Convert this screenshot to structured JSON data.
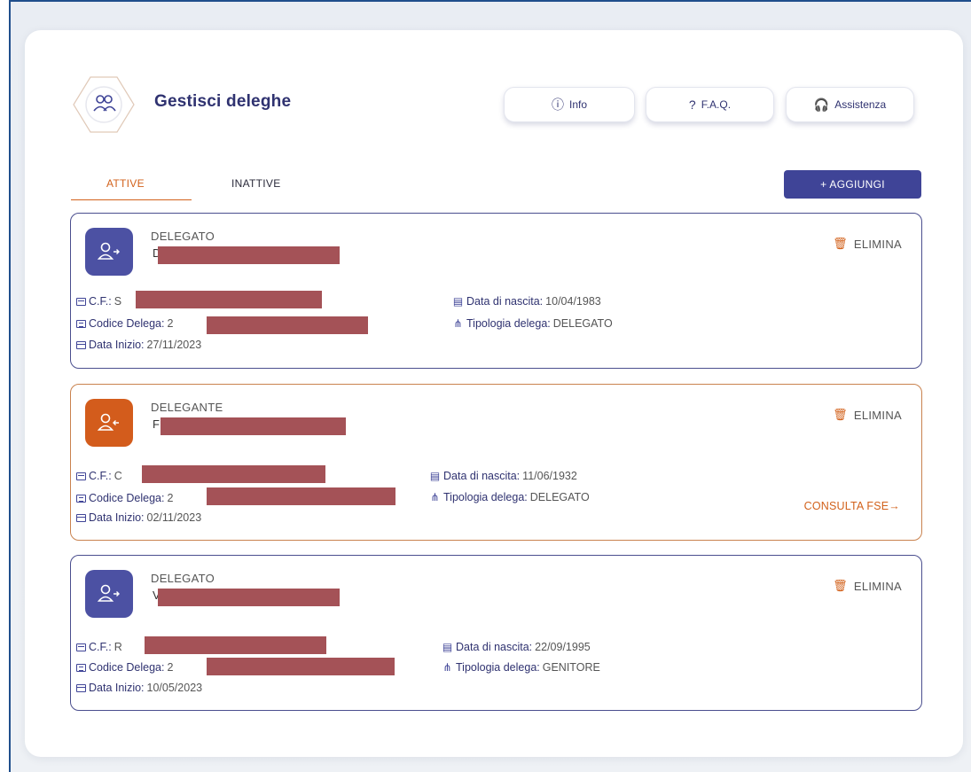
{
  "header": {
    "title": "Gestisci deleghe",
    "buttons": {
      "info": "Info",
      "faq": "F.A.Q.",
      "assistenza": "Assistenza"
    }
  },
  "tabs": {
    "active": "ATTIVE",
    "inactive": "INATTIVE"
  },
  "add_button": "+ AGGIUNGI",
  "labels": {
    "cf": "C.F.:",
    "codice": "Codice Delega:",
    "data_inizio": "Data Inizio:",
    "data_nascita": "Data di nascita:",
    "tipologia": "Tipologia delega:",
    "elimina": "ELIMINA",
    "consulta": "CONSULTA FSE→"
  },
  "cards": [
    {
      "role": "DELEGATO",
      "name_initial": "D",
      "cf_initial": "S",
      "codice_initial": "2",
      "data_inizio": "27/11/2023",
      "data_nascita": "10/04/1983",
      "tipologia": "DELEGATO"
    },
    {
      "role": "DELEGANTE",
      "name_initial": "F",
      "cf_initial": "C",
      "codice_initial": "2",
      "data_inizio": "02/11/2023",
      "data_nascita": "11/06/1932",
      "tipologia": "DELEGATO"
    },
    {
      "role": "DELEGATO",
      "name_initial": "V",
      "cf_initial": "R",
      "codice_initial": "2",
      "data_inizio": "10/05/2023",
      "data_nascita": "22/09/1995",
      "tipologia": "GENITORE"
    }
  ],
  "colors": {
    "primary": "#3f4497",
    "accent": "#d2611b",
    "redaction": "#a45257"
  }
}
